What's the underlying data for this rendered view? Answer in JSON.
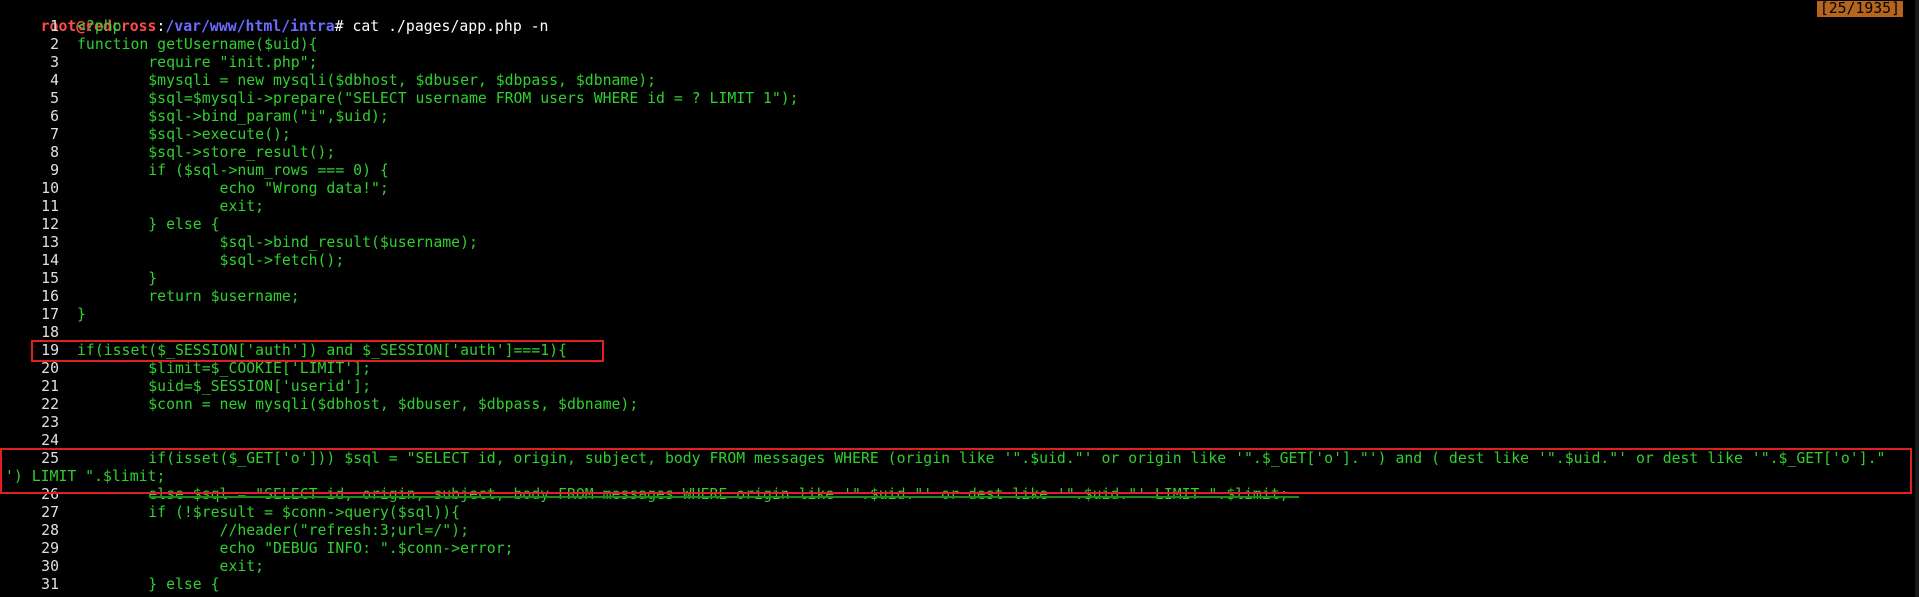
{
  "prompt": {
    "user_host": "root@redcross",
    "sep": ":",
    "path": "/var/www/html/intra",
    "symbol": "#",
    "command": " cat ./pages/app.php -n"
  },
  "counter": "[25/1935]",
  "lines": [
    {
      "n": "1",
      "text": "<?php"
    },
    {
      "n": "2",
      "text": "function getUsername($uid){"
    },
    {
      "n": "3",
      "text": "        require \"init.php\";"
    },
    {
      "n": "4",
      "text": "        $mysqli = new mysqli($dbhost, $dbuser, $dbpass, $dbname);"
    },
    {
      "n": "5",
      "text": "        $sql=$mysqli->prepare(\"SELECT username FROM users WHERE id = ? LIMIT 1\");"
    },
    {
      "n": "6",
      "text": "        $sql->bind_param(\"i\",$uid);"
    },
    {
      "n": "7",
      "text": "        $sql->execute();"
    },
    {
      "n": "8",
      "text": "        $sql->store_result();"
    },
    {
      "n": "9",
      "text": "        if ($sql->num_rows === 0) {"
    },
    {
      "n": "10",
      "text": "                echo \"Wrong data!\";"
    },
    {
      "n": "11",
      "text": "                exit;"
    },
    {
      "n": "12",
      "text": "        } else {"
    },
    {
      "n": "13",
      "text": "                $sql->bind_result($username);"
    },
    {
      "n": "14",
      "text": "                $sql->fetch();"
    },
    {
      "n": "15",
      "text": "        }"
    },
    {
      "n": "16",
      "text": "        return $username;"
    },
    {
      "n": "17",
      "text": "}"
    },
    {
      "n": "18",
      "text": ""
    },
    {
      "n": "19",
      "text": "if(isset($_SESSION['auth']) and $_SESSION['auth']===1){"
    },
    {
      "n": "20",
      "text": "        $limit=$_COOKIE['LIMIT'];"
    },
    {
      "n": "21",
      "text": "        $uid=$_SESSION['userid'];"
    },
    {
      "n": "22",
      "text": "        $conn = new mysqli($dbhost, $dbuser, $dbpass, $dbname);"
    },
    {
      "n": "23",
      "text": ""
    },
    {
      "n": "24",
      "text": ""
    },
    {
      "n": "25",
      "text": "        if(isset($_GET['o'])) $sql = \"SELECT id, origin, subject, body FROM messages WHERE (origin like '\".$uid.\"' or origin like '\".$_GET['o'].\"') and ( dest like '\".$uid.\"' or dest like '\".$_GET['o'].\""
    },
    {
      "n": "",
      "text": "') LIMIT \".$limit;"
    },
    {
      "n": "26",
      "text": "        else $sql = \"SELECT id, origin, subject, body FROM messages WHERE origin like '\".$uid.\"' or dest like '\".$uid.\"' LIMIT \".$limit;"
    },
    {
      "n": "27",
      "text": "        if (!$result = $conn->query($sql)){"
    },
    {
      "n": "28",
      "text": "                //header(\"refresh:3;url=/\");"
    },
    {
      "n": "29",
      "text": "                echo \"DEBUG INFO: \".$conn->error;"
    },
    {
      "n": "30",
      "text": "                exit;"
    },
    {
      "n": "31",
      "text": "        } else {"
    }
  ],
  "colors": {
    "background": "#000000",
    "code": "#2fd02f",
    "user": "#ff4b4b",
    "path": "#6b6bff",
    "highlight_box": "#e02020",
    "counter_bg": "#b5651d"
  }
}
